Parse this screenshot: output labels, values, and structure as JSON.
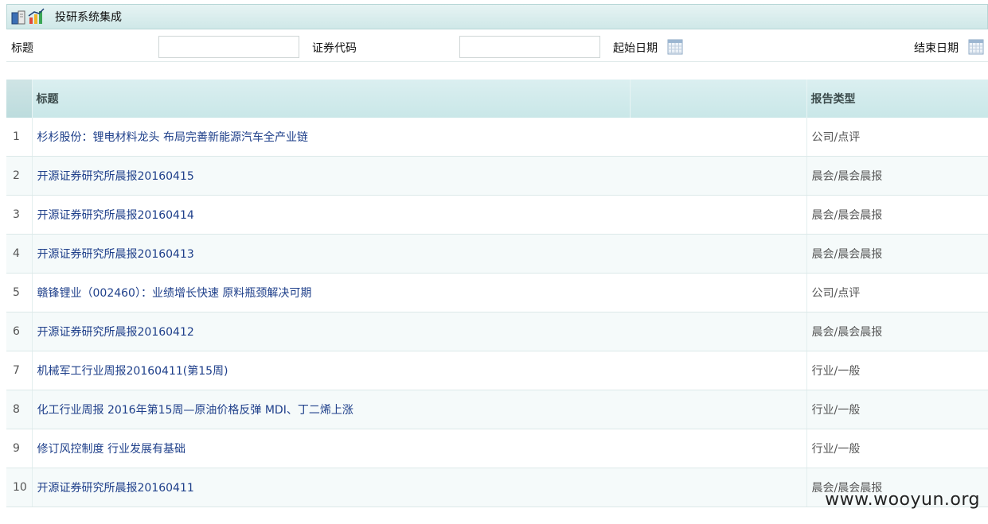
{
  "app": {
    "title": "投研系统集成"
  },
  "filters": {
    "title_label": "标题",
    "title_value": "",
    "code_label": "证券代码",
    "code_value": "",
    "start_label": "起始日期",
    "end_label": "结束日期"
  },
  "icons": {
    "app": "books-chart-icon",
    "calendar": "calendar-icon"
  },
  "table": {
    "columns": [
      "标题",
      "报告类型"
    ],
    "rows": [
      {
        "num": "1",
        "title": "杉杉股份：锂电材料龙头 布局完善新能源汽车全产业链",
        "type": "公司/点评"
      },
      {
        "num": "2",
        "title": "开源证券研究所晨报20160415",
        "type": "晨会/晨会晨报"
      },
      {
        "num": "3",
        "title": "开源证券研究所晨报20160414",
        "type": "晨会/晨会晨报"
      },
      {
        "num": "4",
        "title": "开源证券研究所晨报20160413",
        "type": "晨会/晨会晨报"
      },
      {
        "num": "5",
        "title": "赣锋锂业（002460）：业绩增长快速 原料瓶颈解决可期",
        "type": "公司/点评"
      },
      {
        "num": "6",
        "title": "开源证券研究所晨报20160412",
        "type": "晨会/晨会晨报"
      },
      {
        "num": "7",
        "title": "机械军工行业周报20160411(第15周)",
        "type": "行业/一般"
      },
      {
        "num": "8",
        "title": "化工行业周报 2016年第15周—原油价格反弹 MDI、丁二烯上涨",
        "type": "行业/一般"
      },
      {
        "num": "9",
        "title": "修订风控制度 行业发展有基础",
        "type": "行业/一般"
      },
      {
        "num": "10",
        "title": "开源证券研究所晨报20160411",
        "type": "晨会/晨会晨报"
      }
    ]
  },
  "watermark": "www.wooyun.org",
  "colors": {
    "header_bg": "#cfe8e8",
    "link": "#1e3f8a"
  }
}
